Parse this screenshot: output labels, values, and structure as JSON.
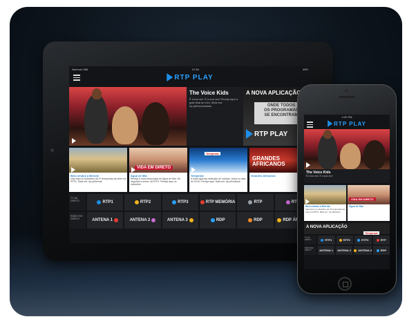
{
  "brand": {
    "name": "RTP PLAY",
    "accent": "#1e8fe8"
  },
  "tablet": {
    "status": {
      "carrier": "Nenhum SIM",
      "time": "12:36",
      "battery": "45%"
    },
    "hero": {
      "title": "The Voice Kids",
      "description": "É a tua vez. É a sua vez! Reveja aqui a gala final ao vivo. Mais em: rtp.pt/thevoicekids"
    },
    "ad": {
      "title": "A NOVA APLICAÇÃO",
      "box_line1": "ONDE TODOS",
      "box_line2": "OS PROGRAMAS",
      "box_line3": "SE ENCONTRAM"
    },
    "tiles": [
      {
        "title": "Bem-vindos a Beirute",
        "desc": "Veja aqui os episódios da 2ª temporada da série na RTP1. Mais em: rtp.pt/beirute"
      },
      {
        "title": "Água de Mar",
        "desc": "Reveja a nova temporada de Água de Mar. De segunda a sexta, na RTP1. Reveja aqui os episódios",
        "badge": "VIDA EM DIRETO"
      },
      {
        "title": "Telejornal",
        "desc": "A mais rigorosa selecção de notícias, todos os dias às 20:00. Reveja aqui. Mais em: rtp.pt/noticias",
        "badge": "Telejornal"
      },
      {
        "title": "Grandes Africanos",
        "desc": "",
        "badge": "GRANDES AFRICANOS"
      }
    ],
    "channels": {
      "tv_label": "TV NA DIRETO",
      "radio_label": "RÁDIO EM DIRETO",
      "tv": [
        {
          "name": "RTP1",
          "color": "#1e8fe8"
        },
        {
          "name": "RTP2",
          "color": "#f3b21b"
        },
        {
          "name": "RTP3",
          "color": "#2aa0ff"
        },
        {
          "name": "RTP MEMÓRIA",
          "color": "#e53c2f"
        },
        {
          "name": "RTP",
          "color": "#9aa0a8"
        },
        {
          "name": "RTP",
          "color": "#c86bd0"
        }
      ],
      "radio": [
        {
          "name": "ANTENA 1",
          "color": "#e53c2f"
        },
        {
          "name": "ANTENA 2",
          "color": "#c86bd0"
        },
        {
          "name": "ANTENA 3",
          "color": "#f3b21b"
        },
        {
          "name": "RDP",
          "color": "#2aa0ff"
        },
        {
          "name": "RDP",
          "color": "#f08a24"
        },
        {
          "name": "RDP ÁFRICA",
          "color": "#f3b21b"
        }
      ]
    }
  },
  "phone": {
    "status": {
      "time": "4:20 PM"
    },
    "hero": {
      "title": "The Voice Kids",
      "description": "É a tua vez. É a sua vez!"
    },
    "tiles": [
      {
        "title": "Bem-vindos a Beirute",
        "desc": "Veja aqui os episódios da 2ª temporada da série na RTP1. Mais em: rtp.pt/beirute"
      },
      {
        "title": "Água de Mar",
        "desc": "",
        "badge": "VIDA EM DIRETO"
      }
    ],
    "ad": {
      "title": "A NOVA APLICAÇÃO",
      "badge": "Telejornal"
    },
    "channels": {
      "tv_label": "TV NA DIRETO",
      "radio_label": "RÁDIO EM DIRETO",
      "tv": [
        {
          "name": "RTP1",
          "color": "#1e8fe8"
        },
        {
          "name": "RTP2",
          "color": "#f3b21b"
        },
        {
          "name": "RTP3",
          "color": "#2aa0ff"
        },
        {
          "name": "RTP",
          "color": "#e53c2f"
        }
      ],
      "radio": [
        {
          "name": "ANTENA 1",
          "color": "#e53c2f"
        },
        {
          "name": "ANTENA 2",
          "color": "#c86bd0"
        },
        {
          "name": "ANTENA 3",
          "color": "#f3b21b"
        },
        {
          "name": "RDP",
          "color": "#2aa0ff"
        }
      ]
    }
  }
}
